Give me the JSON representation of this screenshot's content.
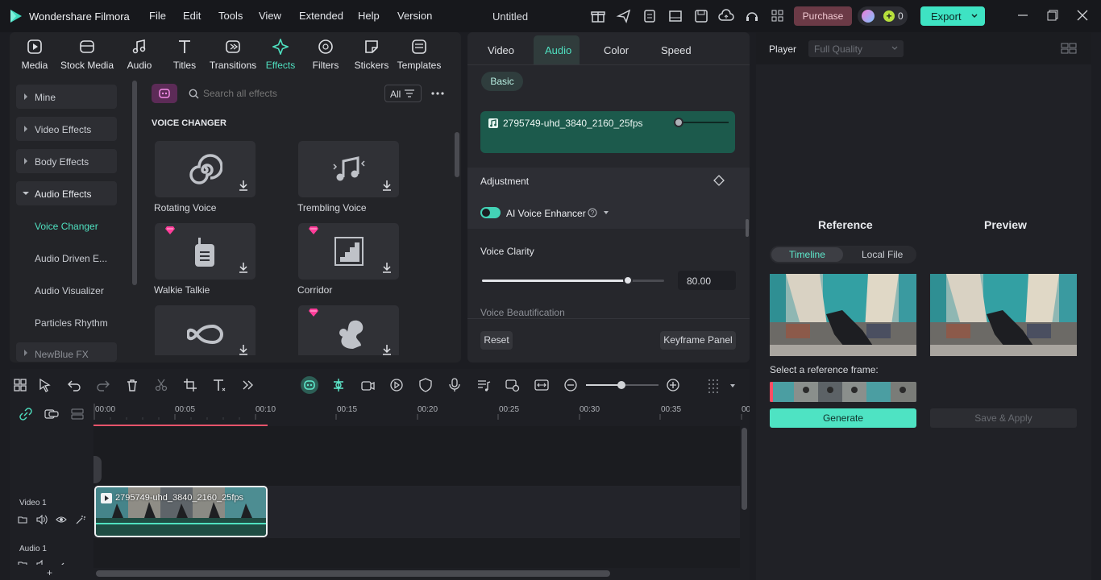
{
  "app": {
    "name": "Wondershare Filmora",
    "project_title": "Untitled",
    "credits": "0"
  },
  "menu": [
    "File",
    "Edit",
    "Tools",
    "View",
    "Extended",
    "Help",
    "Version"
  ],
  "header_buttons": {
    "purchase": "Purchase",
    "export": "Export"
  },
  "categories": [
    "Media",
    "Stock Media",
    "Audio",
    "Titles",
    "Transitions",
    "Effects",
    "Filters",
    "Stickers",
    "Templates"
  ],
  "active_category": "Effects",
  "sidebar": {
    "items": [
      "Mine",
      "Video Effects",
      "Body Effects",
      "Audio Effects"
    ],
    "sub_items": [
      "Voice Changer",
      "Audio Driven E...",
      "Audio Visualizer",
      "Particles Rhythm"
    ],
    "more": "NewBlue FX"
  },
  "search": {
    "placeholder": "Search all effects",
    "filter": "All"
  },
  "section_title": "VOICE CHANGER",
  "effects": [
    {
      "label": "Rotating Voice",
      "premium": false
    },
    {
      "label": "Trembling Voice",
      "premium": false
    },
    {
      "label": "Walkie Talkie",
      "premium": true
    },
    {
      "label": "Corridor",
      "premium": true
    },
    {
      "label": "",
      "premium": false
    },
    {
      "label": "",
      "premium": true
    }
  ],
  "props": {
    "tabs": [
      "Video",
      "Audio",
      "Color",
      "Speed"
    ],
    "active_tab": "Audio",
    "subtab": "Basic",
    "clip_name": "2795749-uhd_3840_2160_25fps",
    "adjustment": "Adjustment",
    "ai_enhancer": "AI Voice Enhancer",
    "voice_clarity": "Voice Clarity",
    "voice_clarity_value": "80.00",
    "voice_clarity_fraction": 0.8,
    "voice_beautification": "Voice Beautification",
    "reset": "Reset",
    "keyframe": "Keyframe Panel"
  },
  "player": {
    "label": "Player",
    "quality": "Full Quality",
    "reference": "Reference",
    "preview": "Preview",
    "tabs": [
      "Timeline",
      "Local File"
    ],
    "select_frame": "Select a reference frame:",
    "generate": "Generate",
    "save_apply": "Save & Apply"
  },
  "timeline": {
    "ruler": [
      "00:00",
      "00:05",
      "00:10",
      "00:15",
      "00:20",
      "00:25",
      "00:30",
      "00:35",
      "00"
    ],
    "tracks": {
      "video": "Video 1",
      "audio": "Audio 1"
    },
    "clip_label": "2795749-uhd_3840_2160_25fps"
  },
  "colors": {
    "accent": "#4fe0c0",
    "purchase_bg": "#6b3a46",
    "brand": "#33d0b4"
  }
}
